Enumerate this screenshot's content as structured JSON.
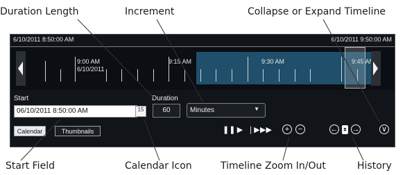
{
  "callouts": {
    "duration_length": "Duration Length",
    "increment": "Increment",
    "collapse_expand": "Collapse or Expand Timeline",
    "start_field": "Start Field",
    "calendar_icon": "Calendar Icon",
    "zoom": "Timeline Zoom In/Out",
    "history": "History"
  },
  "timeline": {
    "range_start": "6/10/2011 8:50:00 AM",
    "range_end": "6/10/2011 9:50:00 AM",
    "labels": [
      {
        "time": "9:00 AM",
        "date": "6/10/2011"
      },
      {
        "time": "9:15 AM"
      },
      {
        "time": "9:30 AM"
      },
      {
        "time": "9:45 AM"
      }
    ]
  },
  "form": {
    "start_label": "Start",
    "start_value": "06/10/2011 8:50:00 AM",
    "calendar_day": "15",
    "duration_label": "Duration",
    "duration_value": "60",
    "increment_value": "Minutes"
  },
  "tabs": [
    "Calendar",
    "Thumbnails"
  ],
  "colors": {
    "panel_bg": "#111418",
    "selected_range": "#1f4f6a"
  },
  "icons": [
    "pause-icon",
    "play-icon",
    "step-forward-icon",
    "fast-forward-icon",
    "zoom-in-icon",
    "zoom-out-icon",
    "history-back-icon",
    "history-clock-icon",
    "history-forward-icon",
    "collapse-expand-icon",
    "chevron-down-icon",
    "left-arrow-icon",
    "right-arrow-icon"
  ]
}
